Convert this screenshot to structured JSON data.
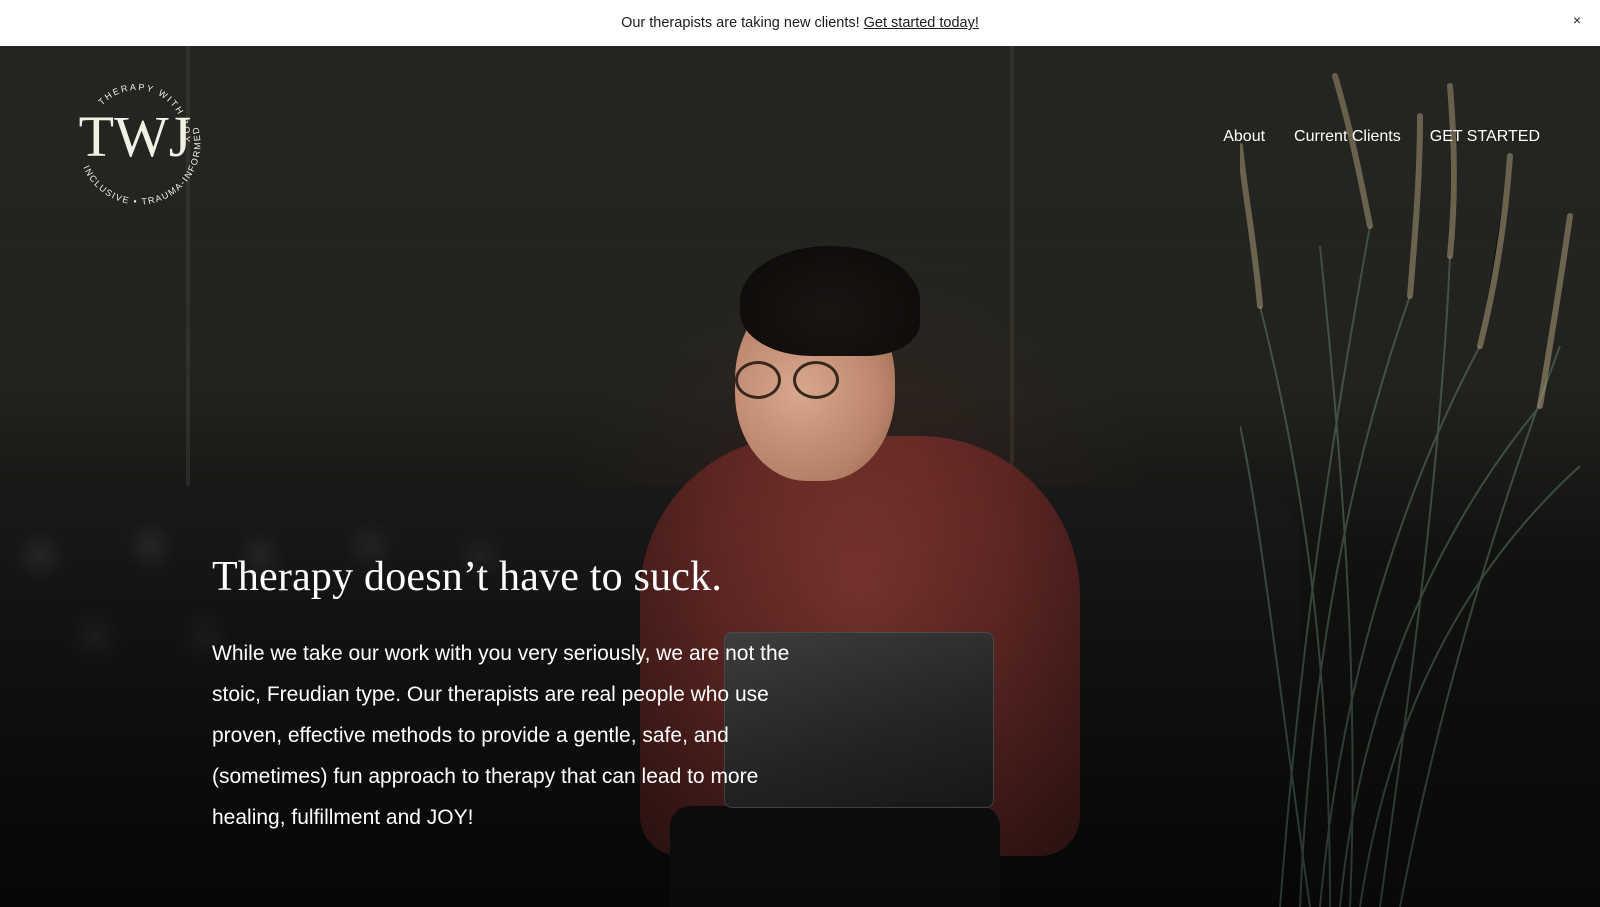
{
  "announcement": {
    "text": "Our therapists are taking new clients!",
    "link_label": "Get started today!",
    "close_label": "×"
  },
  "logo": {
    "monogram": "TWJ",
    "ring_top": "THERAPY WITH JOY",
    "ring_bottom": "INCLUSIVE • TRAUMA-INFORMED"
  },
  "nav": {
    "items": [
      {
        "label": "About"
      },
      {
        "label": "Current Clients"
      },
      {
        "label": "GET STARTED"
      }
    ]
  },
  "hero": {
    "headline": "Therapy doesn’t have to suck.",
    "body": "While we take our work with you very seriously, we are not the stoic, Freudian type. Our therapists are real people who use proven, effective methods to provide a gentle, safe, and (sometimes) fun approach to therapy that can lead to more healing, fulfillment and JOY!"
  },
  "colors": {
    "announcement_bg": "#ffffff",
    "hero_text": "#ffffff",
    "sweater": "#7a322d"
  }
}
